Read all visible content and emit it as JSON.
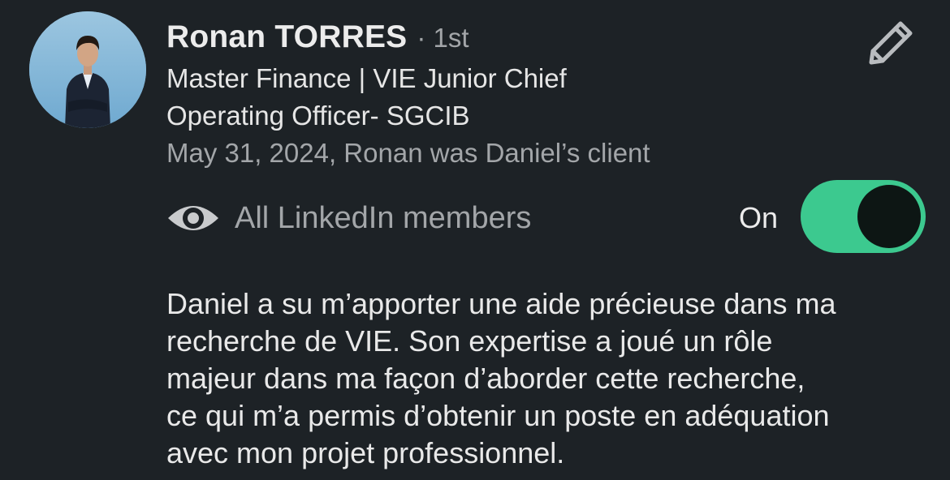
{
  "recommendation": {
    "name": "Ronan TORRES",
    "degree": "· 1st",
    "headline_lines": [
      "Master Finance | VIE Junior Chief",
      "Operating Officer- SGCIB"
    ],
    "relation": "May 31, 2024, Ronan was Daniel’s client",
    "avatar_icon": "profile-photo",
    "edit_icon": "pencil-icon"
  },
  "visibility": {
    "icon": "eye-icon",
    "label": "All LinkedIn members",
    "toggle_state": "On",
    "toggle_on": true,
    "toggle_color": "#3cc98f"
  },
  "body": {
    "lines": [
      "Daniel a su m’apporter une aide précieuse dans ma",
      "recherche de VIE. Son expertise a joué un rôle",
      "majeur dans ma façon d’aborder cette recherche,",
      "ce qui m’a permis d’obtenir un poste en adéquation",
      "avec mon projet professionnel."
    ]
  },
  "colors": {
    "background": "#1d2226",
    "secondary_text": "#a3a6a9",
    "accent": "#3cc98f"
  }
}
